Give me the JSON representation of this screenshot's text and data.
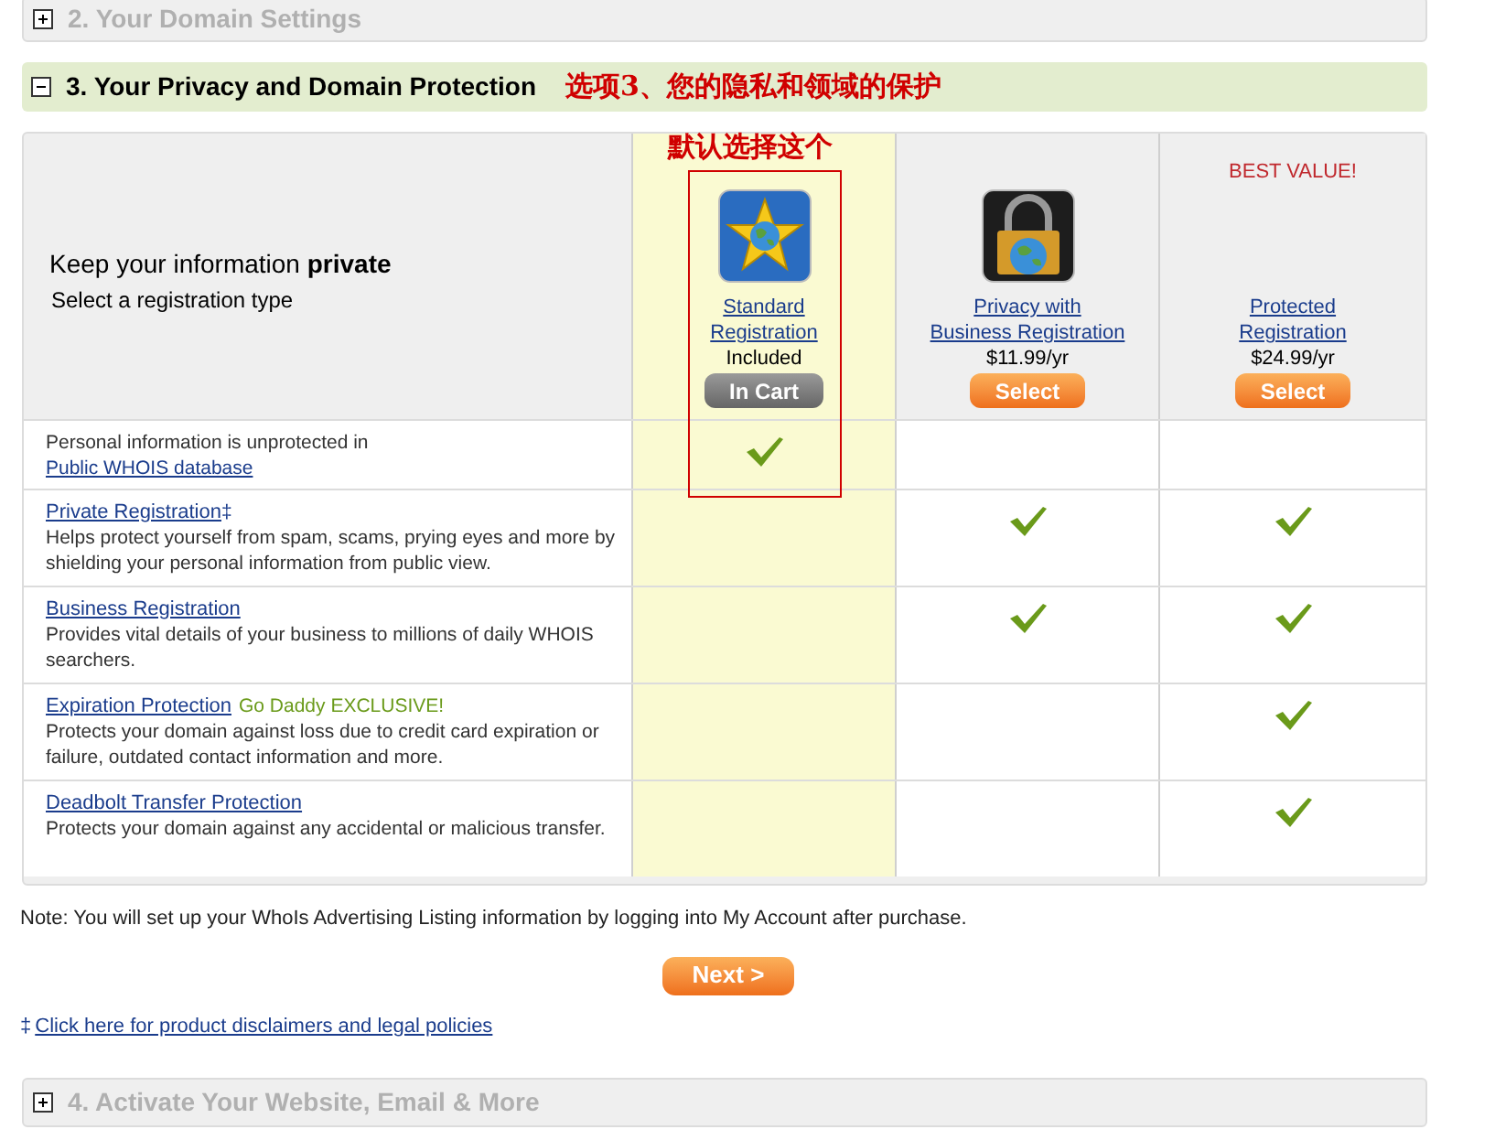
{
  "sections_before": [
    {
      "title": "2. Your Domain Settings",
      "expanded": false
    }
  ],
  "section": {
    "title": "3. Your Privacy and Domain Protection",
    "expanded": true,
    "annotation": "选项3、您的隐私和领域的保护"
  },
  "intro": {
    "heading": "Keep your information ",
    "heading_bold": "private",
    "subheading": "Select a registration type"
  },
  "callout": "默认选择这个",
  "plans": [
    {
      "name": [
        "Standard",
        "Registration"
      ],
      "price": "Included",
      "button": "In Cart",
      "kind": "in_cart",
      "selected": true
    },
    {
      "name": [
        "Privacy with",
        "Business Registration"
      ],
      "price": "$11.99/yr",
      "button": "Select",
      "kind": "select",
      "selected": false
    },
    {
      "name": [
        "Protected",
        "Registration"
      ],
      "price": "$24.99/yr",
      "button": "Select",
      "kind": "select",
      "badge": "BEST VALUE!",
      "selected": false
    }
  ],
  "features": [
    {
      "kind": "note",
      "text": "Personal information is unprotected in",
      "link": "Public WHOIS database",
      "checks": [
        true,
        false,
        false
      ]
    },
    {
      "kind": "titled",
      "title": "Private Registration",
      "mark": "‡",
      "description": "Helps protect yourself from spam, scams, prying eyes and more by shielding your personal information from public view.",
      "checks": [
        false,
        true,
        true
      ]
    },
    {
      "kind": "titled",
      "title": "Business Registration",
      "description": "Provides vital details of your business to millions of daily WHOIS searchers.",
      "checks": [
        false,
        true,
        true
      ]
    },
    {
      "kind": "titled",
      "title": "Expiration Protection",
      "tag": "Go Daddy EXCLUSIVE!",
      "description": "Protects your domain against loss due to credit card expiration or failure, outdated contact information and more.",
      "checks": [
        false,
        false,
        true
      ]
    },
    {
      "kind": "titled",
      "title": "Deadbolt Transfer Protection",
      "description": "Protects your domain against any accidental or malicious transfer.",
      "checks": [
        false,
        false,
        true
      ]
    }
  ],
  "note": "Note: You will set up your WhoIs Advertising Listing information by logging into My Account after purchase.",
  "next_button": "Next >",
  "disclaimer": {
    "mark": "‡",
    "link": "Click here for product disclaimers and legal policies"
  },
  "sections_after": [
    {
      "title": "4. Activate Your Website, Email & More",
      "expanded": false
    }
  ]
}
